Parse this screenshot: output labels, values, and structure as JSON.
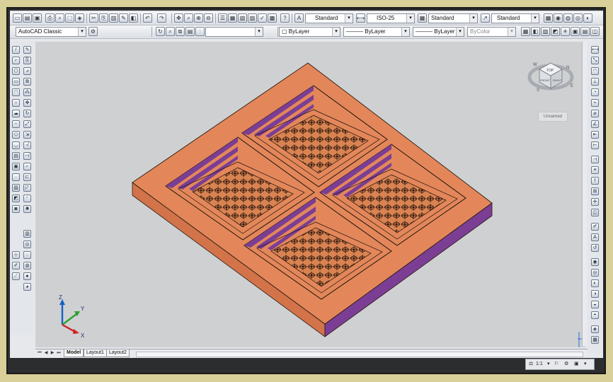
{
  "toolbar_top": {
    "text_style": "Standard",
    "dim_style": "ISO-25",
    "table_style": "Standard",
    "mleader_style": "Standard"
  },
  "toolbar_second": {
    "workspace": "AutoCAD Classic",
    "layer": "",
    "color": "ByLayer",
    "linetype": "ByLayer",
    "lineweight": "ByLayer",
    "plotstyle": "ByColor"
  },
  "viewcube": {
    "top_face": "TOP",
    "front_face": "FRONT",
    "right_face": "RIGHT",
    "compass_n": "N",
    "compass_e": "E",
    "compass_s": "S",
    "compass_w": "W",
    "ucs_label": "Unnamed"
  },
  "ucs_axes": {
    "x": "X",
    "y": "Y",
    "z": "Z"
  },
  "layout_tabs": [
    "Model",
    "Layout1",
    "Layout2"
  ],
  "status": {
    "annotation_scale": "1:1"
  },
  "colors": {
    "panel_top": "#e3875a",
    "panel_side_left": "#d2734a",
    "panel_side_right": "#7b3e94",
    "viewport_bg": "#cfd0d2",
    "frame": "#d9cf98"
  }
}
